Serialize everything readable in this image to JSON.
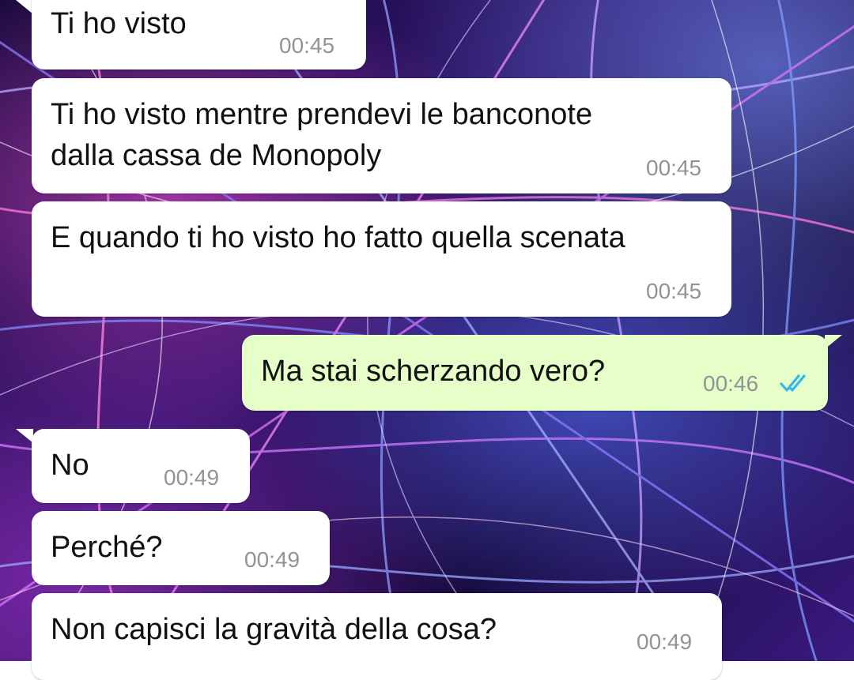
{
  "messages": [
    {
      "direction": "incoming",
      "text": "Ti ho visto",
      "time": "00:45"
    },
    {
      "direction": "incoming",
      "text": "Ti ho visto mentre prendevi le banconote\ndalla cassa de Monopoly",
      "time": "00:45"
    },
    {
      "direction": "incoming",
      "text": "E quando ti ho visto ho fatto quella scenata",
      "time": "00:45"
    },
    {
      "direction": "outgoing",
      "text": "Ma stai scherzando vero?",
      "time": "00:46",
      "status_icon": "double-check-read-icon"
    },
    {
      "direction": "incoming",
      "text": "No",
      "time": "00:49"
    },
    {
      "direction": "incoming",
      "text": "Perché?",
      "time": "00:49"
    },
    {
      "direction": "incoming",
      "text": "Non capisci la gravità della cosa?",
      "time": "00:49"
    }
  ],
  "colors": {
    "incoming_bubble": "#ffffff",
    "outgoing_bubble": "#e6fec8",
    "timestamp": "#8f9497",
    "read_ticks": "#34b7f1"
  }
}
